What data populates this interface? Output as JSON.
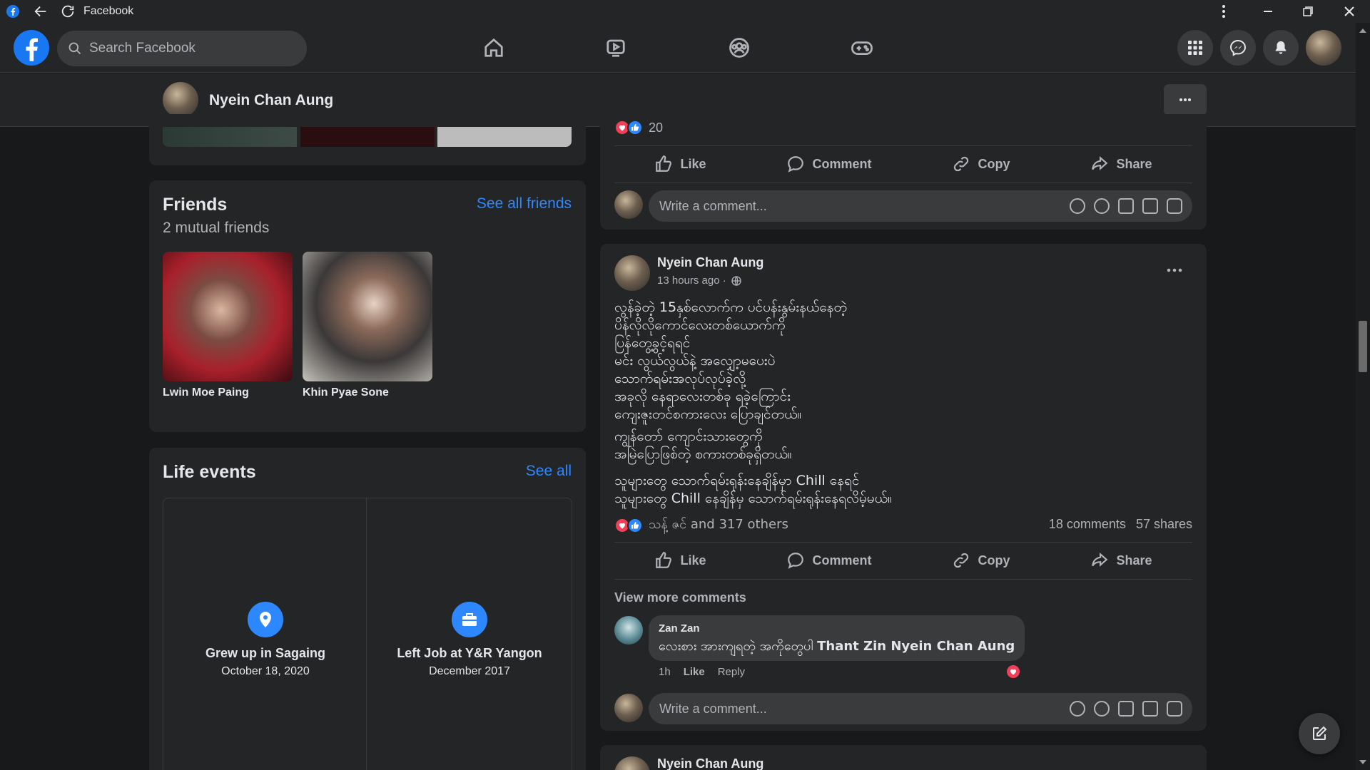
{
  "titlebar": {
    "app_title": "Facebook"
  },
  "nav": {
    "search_placeholder": "Search Facebook"
  },
  "profile": {
    "name": "Nyein Chan Aung"
  },
  "friends": {
    "title": "Friends",
    "see_all": "See all friends",
    "subtitle": "2 mutual friends",
    "items": [
      {
        "name": "Lwin Moe Paing"
      },
      {
        "name": "Khin Pyae Sone"
      }
    ]
  },
  "life_events": {
    "title": "Life events",
    "see_all": "See all",
    "items": [
      {
        "title": "Grew up in Sagaing",
        "date": "October 18, 2020",
        "icon": "location-pin-icon"
      },
      {
        "title": "Left Job at Y&R Yangon",
        "date": "December 2017",
        "icon": "briefcase-icon"
      }
    ]
  },
  "post_top": {
    "reaction_count": "20",
    "actions": {
      "like": "Like",
      "comment": "Comment",
      "copy": "Copy",
      "share": "Share"
    },
    "comment_placeholder": "Write a comment..."
  },
  "post_main": {
    "author": "Nyein Chan Aung",
    "time": "13 hours ago ·",
    "text": "လွန်ခဲ့တဲ့ 15နှစ်လောက်က ပင်ပန်းနွမ်းနယ်နေတဲ့\nပိန်လိုလိုကောင်လေးတစ်ယောက်ကို\nပြန်တွေ့ခွင့်ရရင်\nမင်း လွယ်လွယ်နဲ့ အလျှော့မပေးပဲ\nသောက်ရမ်းအလုပ်လုပ်ခဲ့လို့\nအခုလို နေရာလေးတစ်ခု ရခဲ့ကြောင်း\nကျေးဇူးတင်စကားလေး ပြောချင်တယ်။",
    "text2": "ကျွန်တော် ကျောင်းသားတွေကို\nအမြဲပြောဖြစ်တဲ့ စကားတစ်ခုရှိတယ်။",
    "text3": "သူများတွေ သောက်ရမ်းရုန်းနေချိန်မှာ Chill နေရင်\nသူများတွေ Chill နေချိန်မှ သောက်ရမ်းရုန်းနေရလိမ့်မယ်။",
    "reactions_text": "သန့် ဇင် and 317 others",
    "comments_count": "18 comments",
    "shares_count": "57 shares",
    "actions": {
      "like": "Like",
      "comment": "Comment",
      "copy": "Copy",
      "share": "Share"
    },
    "view_more": "View more comments",
    "comment": {
      "author": "Zan Zan",
      "text": "လေးစား အားကျရတဲ့ အကိုတွေပါ ",
      "mention": "Thant Zin Nyein Chan Aung",
      "time": "1h",
      "like": "Like",
      "reply": "Reply"
    },
    "comment_placeholder": "Write a comment..."
  },
  "post_next": {
    "author": "Nyein Chan Aung"
  },
  "colors": {
    "background": "#18191a",
    "card": "#242526",
    "accent": "#2d88ff",
    "love": "#f33e58"
  }
}
